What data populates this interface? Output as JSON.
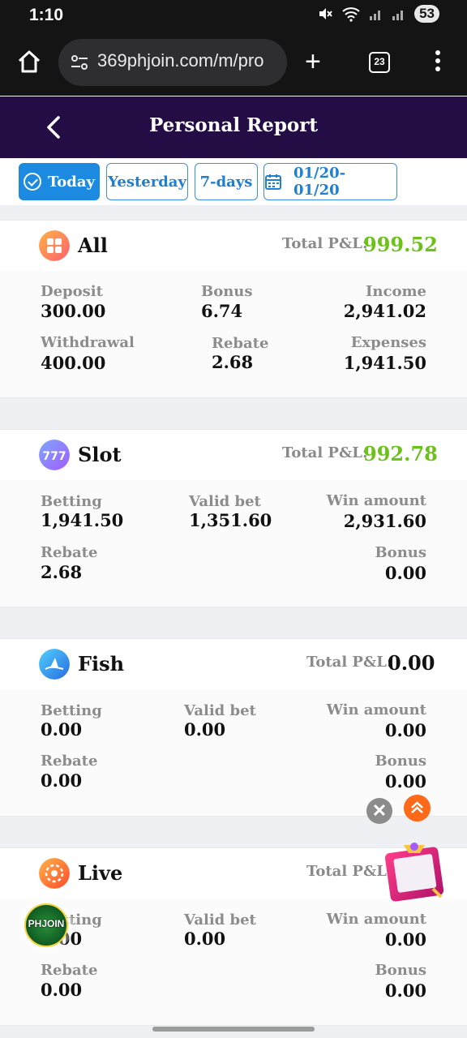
{
  "status_bar": {
    "time": "1:10",
    "battery": "53"
  },
  "browser": {
    "url": "369phjoin.com/m/pro",
    "tab_count": "23"
  },
  "header": {
    "title": "Personal Report"
  },
  "filters": {
    "today": "Today",
    "yesterday": "Yesterday",
    "seven_days": "7-days",
    "date_range": "01/20- 01/20"
  },
  "all": {
    "name": "All",
    "pl_label": "Total P&L:",
    "pl_value": "999.52",
    "deposit_label": "Deposit",
    "deposit_value": "300.00",
    "bonus_label": "Bonus",
    "bonus_value": "6.74",
    "income_label": "Income",
    "income_value": "2,941.02",
    "withdrawal_label": "Withdrawal",
    "withdrawal_value": "400.00",
    "rebate_label": "Rebate",
    "rebate_value": "2.68",
    "expenses_label": "Expenses",
    "expenses_value": "1,941.50"
  },
  "slot": {
    "name": "Slot",
    "pl_label": "Total P&L:",
    "pl_value": "992.78",
    "betting_label": "Betting",
    "betting_value": "1,941.50",
    "valid_label": "Valid bet",
    "valid_value": "1,351.60",
    "win_label": "Win amount",
    "win_value": "2,931.60",
    "rebate_label": "Rebate",
    "rebate_value": "2.68",
    "bonus_label": "Bonus",
    "bonus_value": "0.00"
  },
  "fish": {
    "name": "Fish",
    "pl_label": "Total P&L:",
    "pl_value": "0.00",
    "betting_label": "Betting",
    "betting_value": "0.00",
    "valid_label": "Valid bet",
    "valid_value": "0.00",
    "win_label": "Win amount",
    "win_value": "0.00",
    "rebate_label": "Rebate",
    "rebate_value": "0.00",
    "bonus_label": "Bonus",
    "bonus_value": "0.00"
  },
  "live": {
    "name": "Live",
    "pl_label": "Total P&L:",
    "betting_label": "Betting",
    "betting_value": "0.00",
    "valid_label": "Valid bet",
    "valid_value": "0.00",
    "win_label": "Win amount",
    "win_value": "0.00",
    "rebate_label": "Rebate",
    "rebate_value": "0.00",
    "bonus_label": "Bonus",
    "bonus_value": "0.00"
  },
  "floating": {
    "close_glyph": "✕",
    "brand_badge": "PHJOIN"
  },
  "colors": {
    "positive": "#6cc11b",
    "neutral": "#111111",
    "header_bg": "#230d44",
    "accent": "#1b8ae0"
  }
}
